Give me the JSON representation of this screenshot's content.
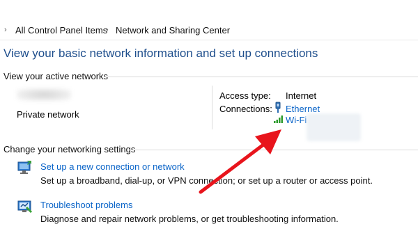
{
  "breadcrumb": {
    "items": [
      "All Control Panel Items",
      "Network and Sharing Center"
    ]
  },
  "page_title": "View your basic network information and set up connections",
  "active_networks": {
    "section_label": "View your active networks",
    "network_type": "Private network",
    "access_type_label": "Access type:",
    "access_type_value": "Internet",
    "connections_label": "Connections:",
    "connections": [
      "Ethernet",
      "Wi-Fi"
    ]
  },
  "settings": {
    "section_label": "Change your networking settings",
    "tasks": [
      {
        "link": "Set up a new connection or network",
        "description": "Set up a broadband, dial-up, or VPN connection; or set up a router or access point."
      },
      {
        "link": "Troubleshoot problems",
        "description": "Diagnose and repair network problems, or get troubleshooting information."
      }
    ]
  },
  "colors": {
    "title": "#1e4e8c",
    "link": "#0a64c8",
    "arrow": "#e8141c"
  },
  "icons": [
    "chevron-right-icon",
    "ethernet-icon",
    "wifi-signal-icon",
    "new-connection-icon",
    "troubleshoot-icon",
    "annotation-arrow"
  ]
}
